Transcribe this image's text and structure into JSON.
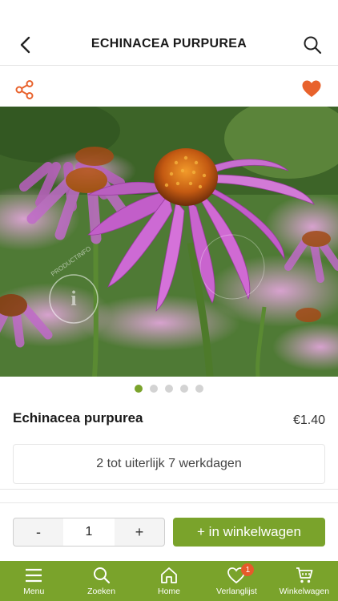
{
  "header": {
    "title": "ECHINACEA PURPUREA"
  },
  "actions": {
    "share_icon": "share-icon",
    "favorite_icon": "heart-icon",
    "accent_color": "#e8622c"
  },
  "gallery": {
    "image_count": 5,
    "active_index": 0,
    "watermark": "PRODUCTINFO"
  },
  "product": {
    "name": "Echinacea purpurea",
    "price": "€1.40",
    "delivery": "2 tot uiterlijk 7 werkdagen"
  },
  "cart": {
    "minus_label": "-",
    "quantity": "1",
    "plus_label": "+",
    "add_label": "+ in winkelwagen"
  },
  "tabbar": {
    "color": "#7aa32b",
    "items": [
      {
        "label": "Menu",
        "icon": "menu-icon"
      },
      {
        "label": "Zoeken",
        "icon": "search-icon"
      },
      {
        "label": "Home",
        "icon": "home-icon"
      },
      {
        "label": "Verlanglijst",
        "icon": "heart-icon",
        "badge": "1"
      },
      {
        "label": "Winkelwagen",
        "icon": "cart-icon"
      }
    ]
  }
}
